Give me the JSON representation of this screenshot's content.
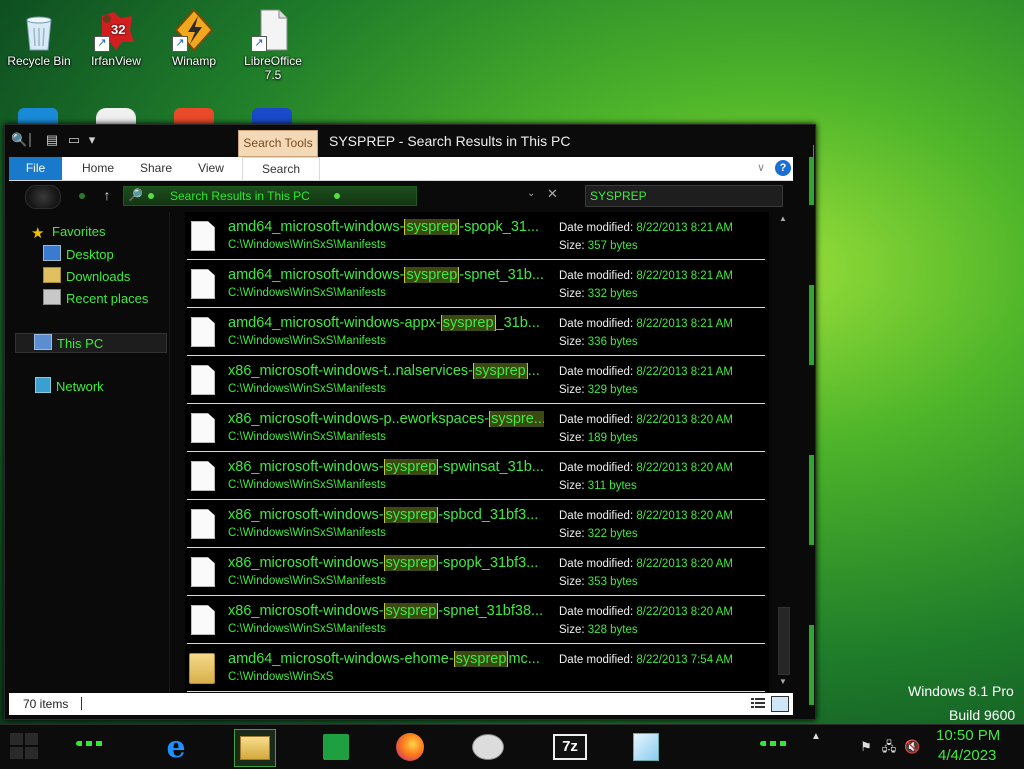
{
  "desktop": {
    "icons": [
      {
        "label": "Recycle Bin"
      },
      {
        "label": "IrfanView",
        "badge": "32"
      },
      {
        "label": "Winamp"
      },
      {
        "label": "LibreOffice 7.5"
      }
    ]
  },
  "window": {
    "title": "SYSPREP - Search Results in This PC",
    "contextual_tab": "Search Tools",
    "ribbon_tabs": [
      "File",
      "Home",
      "Share",
      "View",
      "Search"
    ],
    "address": "Search Results in This PC",
    "search_value": "SYSPREP"
  },
  "sidebar": {
    "favorites_label": "Favorites",
    "favorites": [
      "Desktop",
      "Downloads",
      "Recent places"
    ],
    "this_pc": "This PC",
    "network": "Network"
  },
  "results": [
    {
      "pre": "amd64_microsoft-windows-",
      "hl": "sysprep",
      "post": "-spopk_31...",
      "path": "C:\\Windows\\WinSxS\\Manifests",
      "dm_label": "Date modified:",
      "date": "8/22/2013 8:21 AM",
      "size_label": "Size:",
      "size": "357 bytes",
      "type": "file"
    },
    {
      "pre": "amd64_microsoft-windows-",
      "hl": "sysprep",
      "post": "-spnet_31b...",
      "path": "C:\\Windows\\WinSxS\\Manifests",
      "dm_label": "Date modified:",
      "date": "8/22/2013 8:21 AM",
      "size_label": "Size:",
      "size": "332 bytes",
      "type": "file"
    },
    {
      "pre": "amd64_microsoft-windows-appx-",
      "hl": "sysprep",
      "post": "_31b...",
      "path": "C:\\Windows\\WinSxS\\Manifests",
      "dm_label": "Date modified:",
      "date": "8/22/2013 8:21 AM",
      "size_label": "Size:",
      "size": "336 bytes",
      "type": "file"
    },
    {
      "pre": "x86_microsoft-windows-t..nalservices-",
      "hl": "sysprep",
      "post": "...",
      "path": "C:\\Windows\\WinSxS\\Manifests",
      "dm_label": "Date modified:",
      "date": "8/22/2013 8:21 AM",
      "size_label": "Size:",
      "size": "329 bytes",
      "type": "file"
    },
    {
      "pre": "x86_microsoft-windows-p..eworkspaces-",
      "hl": "syspre...",
      "post": "",
      "path": "C:\\Windows\\WinSxS\\Manifests",
      "dm_label": "Date modified:",
      "date": "8/22/2013 8:20 AM",
      "size_label": "Size:",
      "size": "189 bytes",
      "type": "file"
    },
    {
      "pre": "x86_microsoft-windows-",
      "hl": "sysprep",
      "post": "-spwinsat_31b...",
      "path": "C:\\Windows\\WinSxS\\Manifests",
      "dm_label": "Date modified:",
      "date": "8/22/2013 8:20 AM",
      "size_label": "Size:",
      "size": "311 bytes",
      "type": "file"
    },
    {
      "pre": "x86_microsoft-windows-",
      "hl": "sysprep",
      "post": "-spbcd_31bf3...",
      "path": "C:\\Windows\\WinSxS\\Manifests",
      "dm_label": "Date modified:",
      "date": "8/22/2013 8:20 AM",
      "size_label": "Size:",
      "size": "322 bytes",
      "type": "file"
    },
    {
      "pre": "x86_microsoft-windows-",
      "hl": "sysprep",
      "post": "-spopk_31bf3...",
      "path": "C:\\Windows\\WinSxS\\Manifests",
      "dm_label": "Date modified:",
      "date": "8/22/2013 8:20 AM",
      "size_label": "Size:",
      "size": "353 bytes",
      "type": "file"
    },
    {
      "pre": "x86_microsoft-windows-",
      "hl": "sysprep",
      "post": "-spnet_31bf38...",
      "path": "C:\\Windows\\WinSxS\\Manifests",
      "dm_label": "Date modified:",
      "date": "8/22/2013 8:20 AM",
      "size_label": "Size:",
      "size": "328 bytes",
      "type": "file"
    },
    {
      "pre": "amd64_microsoft-windows-ehome-",
      "hl": "sysprep",
      "post": "mc...",
      "path": "C:\\Windows\\WinSxS",
      "dm_label": "Date modified:",
      "date": "8/22/2013 7:54 AM",
      "size_label": "",
      "size": "",
      "type": "folder"
    }
  ],
  "status": {
    "items": "70 items"
  },
  "branding": {
    "line1": "Windows 8.1 Pro",
    "line2": "Build 9600"
  },
  "clock": {
    "time": "10:50 PM",
    "date": "4/4/2023"
  },
  "taskbar_apps": [
    {
      "name": "internet-explorer",
      "glyph": "e",
      "color": "#1e90ff"
    },
    {
      "name": "file-explorer",
      "glyph": "",
      "color": "#e8c060"
    },
    {
      "name": "store",
      "glyph": "",
      "color": "#20a040"
    },
    {
      "name": "firefox",
      "glyph": "",
      "color": "#ff6a1a"
    },
    {
      "name": "paint",
      "glyph": "",
      "color": "#d0d0d0"
    },
    {
      "name": "7zip",
      "glyph": "7z",
      "color": "#ffffff"
    },
    {
      "name": "notes",
      "glyph": "",
      "color": "#9fd8ff"
    }
  ],
  "colors": {
    "accent_green": "#3fea3f",
    "highlight_border": "#c8c832",
    "file_tab_blue": "#1979ca"
  }
}
